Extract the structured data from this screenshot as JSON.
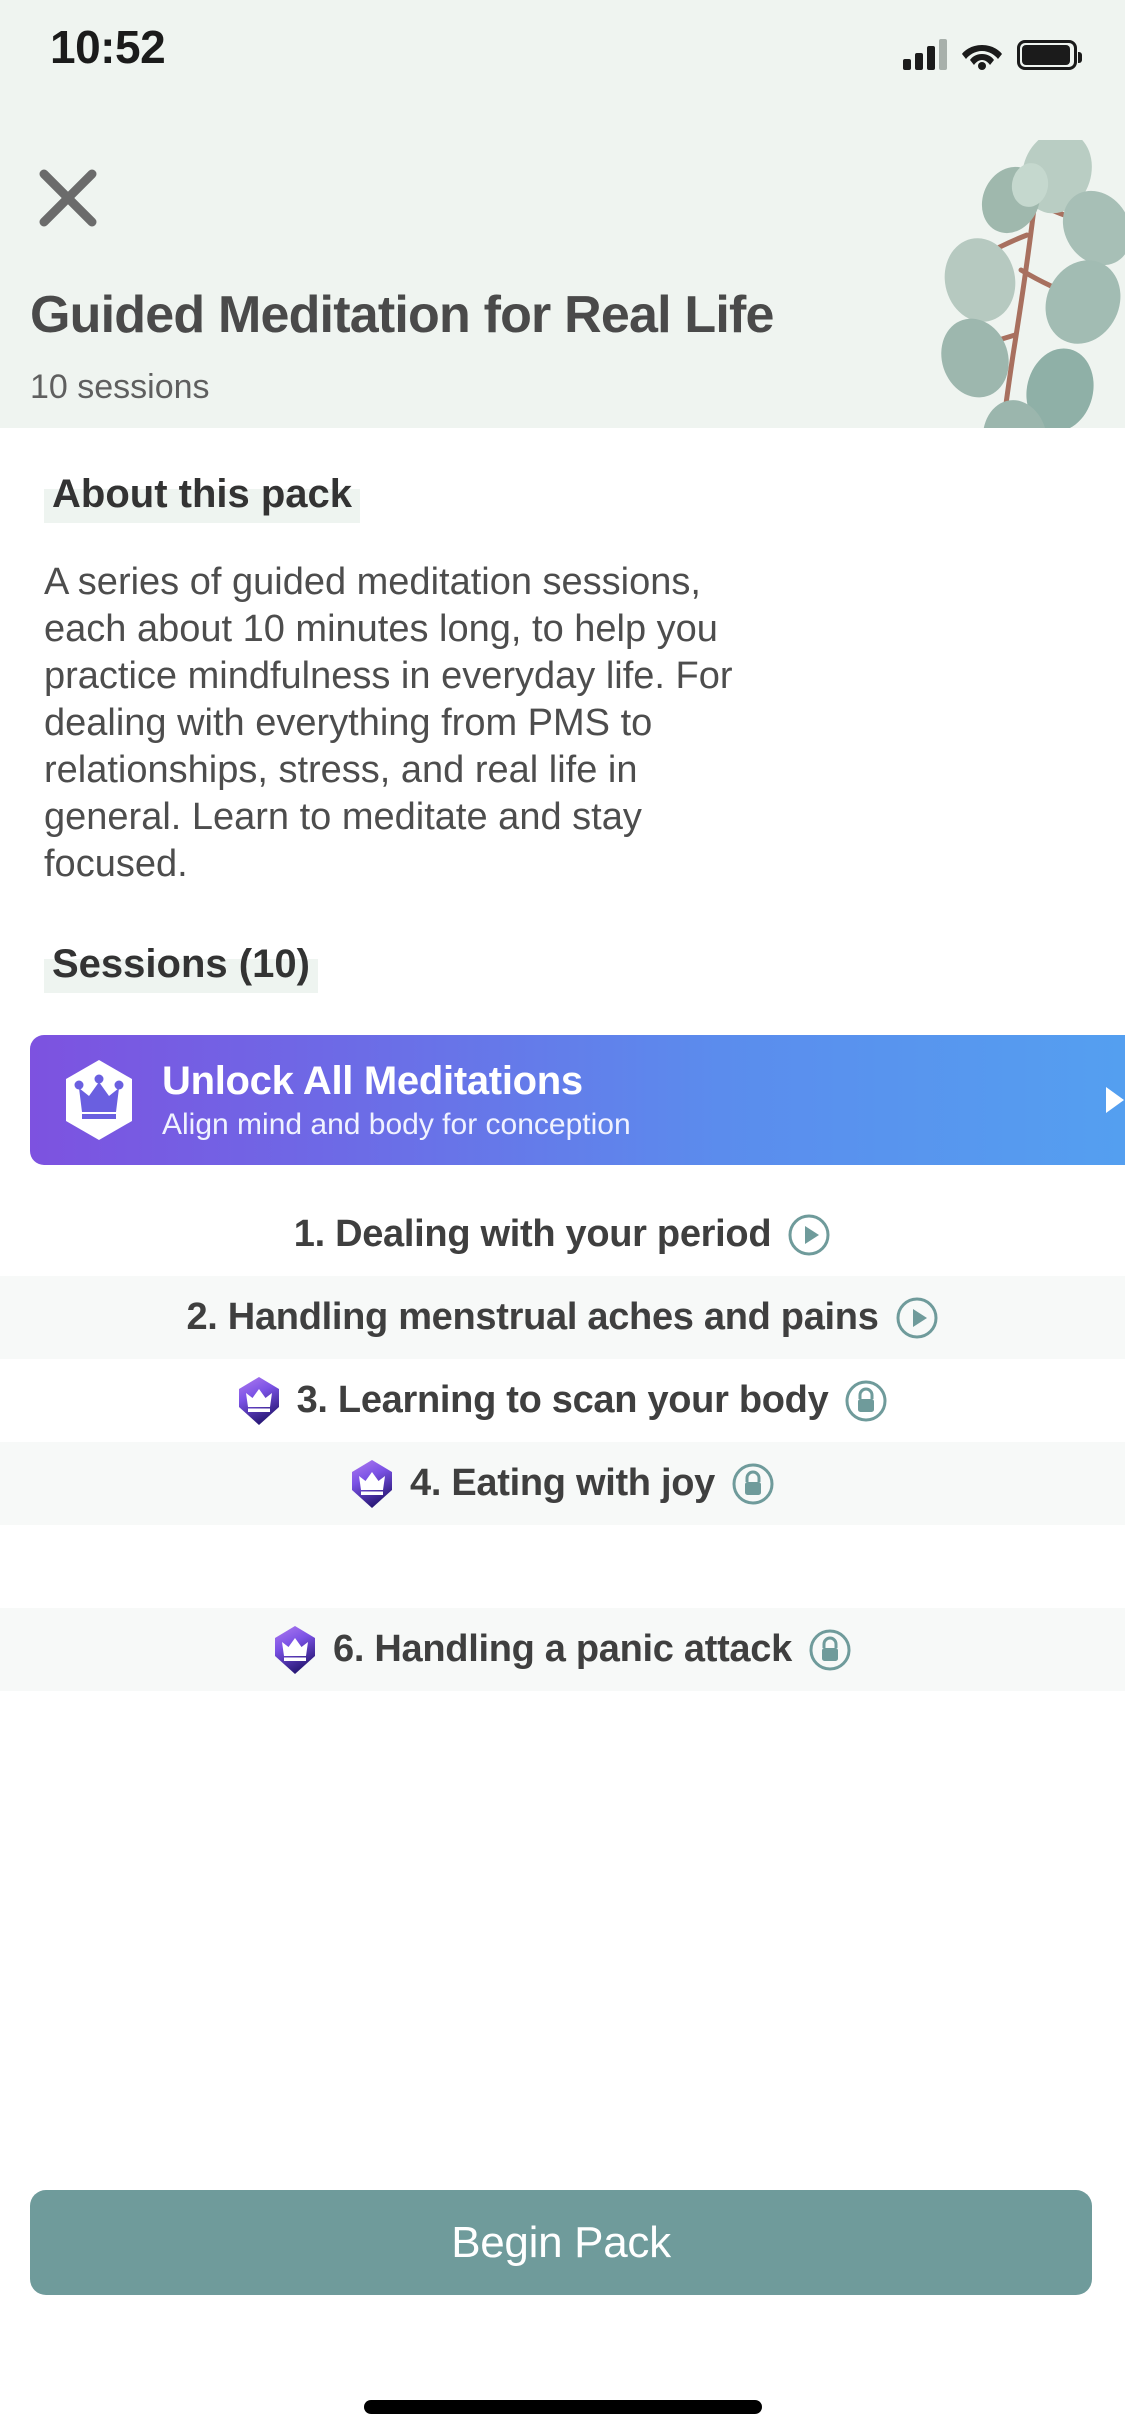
{
  "status_bar": {
    "time": "10:52",
    "icons": [
      "cellular-signal-icon",
      "wifi-icon",
      "battery-icon"
    ]
  },
  "header": {
    "close_icon": "close-icon",
    "title": "Guided Meditation for Real Life",
    "subtitle": "10 sessions",
    "background_color": "#eff4f0",
    "decoration": "eucalyptus-branch-illustration"
  },
  "about": {
    "heading": "About this pack",
    "body": "A series of guided meditation sessions, each about 10 minutes long, to help you practice mindfulness in everyday life. For dealing with everything from PMS to relationships, stress, and real life in general. Learn to meditate and stay focused."
  },
  "sessions_section": {
    "heading": "Sessions (10)"
  },
  "unlock_banner": {
    "title": "Unlock All Meditations",
    "subtitle": "Align mind and body for conception",
    "badge_icon": "premium-crown-badge-icon",
    "arrow_icon": "chevron-right-icon",
    "gradient_from": "#7d52e0",
    "gradient_to": "#54a0f0"
  },
  "sessions": [
    {
      "number": "1.",
      "title": "1. Dealing with your period",
      "locked": false,
      "premium": false,
      "action_icon": "play-circle-icon",
      "striped": false
    },
    {
      "number": "2.",
      "title": "2. Handling menstrual aches and pains",
      "locked": false,
      "premium": false,
      "action_icon": "play-circle-icon",
      "striped": true
    },
    {
      "number": "3.",
      "title": "3. Learning to scan your body",
      "locked": true,
      "premium": true,
      "action_icon": "lock-circle-icon",
      "striped": false
    },
    {
      "number": "4.",
      "title": "4. Eating with joy",
      "locked": true,
      "premium": true,
      "action_icon": "lock-circle-icon",
      "striped": true
    },
    {
      "number": "6.",
      "title": "6. Handling a panic attack",
      "locked": true,
      "premium": true,
      "action_icon": "lock-circle-icon",
      "striped": true
    }
  ],
  "begin_pack": {
    "label": "Begin Pack",
    "color": "#6f9b9b"
  },
  "colors": {
    "accent_teal": "#6f9b9b",
    "header_bg": "#eff4f0",
    "stripe_bg": "#f7f9f8",
    "text_dark": "#3f3f3f",
    "text_body": "#4d4d4d",
    "premium_purple": "#7d52e0"
  }
}
